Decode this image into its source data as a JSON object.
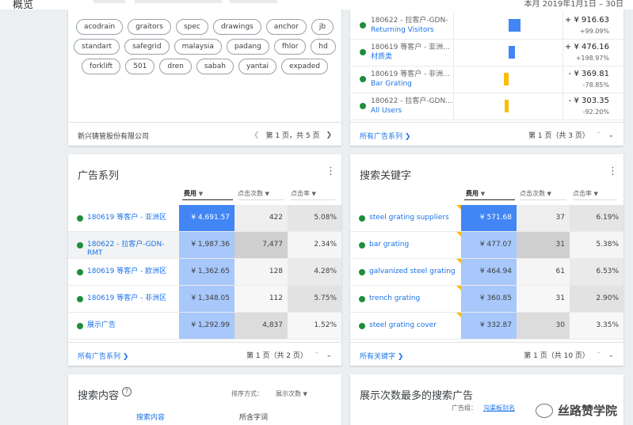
{
  "topbar": {
    "title": "概览",
    "date_range": "本月  2019年1月1日 – 30日"
  },
  "keyword_cloud": {
    "rows": [
      [
        "acodrain",
        "graitors",
        "spec",
        "drawings",
        "anchor",
        "jb"
      ],
      [
        "standart",
        "safegrid",
        "malaysia",
        "padang",
        "fhlor",
        "hd"
      ],
      [
        "forklift",
        "501",
        "dren",
        "sabah",
        "yantai",
        "expaded"
      ]
    ],
    "footer_left": "新兴铸管股份有限公司",
    "footer_page": "第 1 页，共 5 页"
  },
  "changes": {
    "rows": [
      {
        "title": "180622 - 拉客户-GDN-",
        "sub": "Returning Visitors",
        "value": "+ ¥ 916.63",
        "pct": "+99.09%",
        "bar_color": "#4285f4",
        "bar_width": 15
      },
      {
        "title": "180619 等客户 - 亚洲...",
        "sub": "材质类",
        "value": "+ ¥ 476.16",
        "pct": "+198.97%",
        "bar_color": "#4285f4",
        "bar_width": 8
      },
      {
        "title": "180619 等客户 - 非洲...",
        "sub": "Bar Grating",
        "value": "- ¥ 369.81",
        "pct": "-78.85%",
        "bar_color": "#fbbc04",
        "bar_width": 6
      },
      {
        "title": "180622 - 拉客户-GDN...",
        "sub": "All Users",
        "value": "- ¥ 303.35",
        "pct": "-92.20%",
        "bar_color": "#fbbc04",
        "bar_width": 5
      }
    ],
    "footer_link": "所有广告系列",
    "footer_page": "第 1 页（共 3 页）"
  },
  "campaigns": {
    "title": "广告系列",
    "headers": [
      "费用",
      "点击次数",
      "点击率"
    ],
    "rows": [
      {
        "name": "180619 等客户 - 亚洲区",
        "cost": "¥ 4,691.57",
        "clicks": "422",
        "ctr": "5.08%"
      },
      {
        "name": "180622 - 拉客户-GDN-RMT",
        "cost": "¥ 1,987.36",
        "clicks": "7,477",
        "ctr": "2.34%"
      },
      {
        "name": "180619 等客户 - 欧洲区",
        "cost": "¥ 1,362.65",
        "clicks": "128",
        "ctr": "4.28%"
      },
      {
        "name": "180619 等客户 - 非洲区",
        "cost": "¥ 1,348.05",
        "clicks": "112",
        "ctr": "5.75%"
      },
      {
        "name": "展示广告",
        "cost": "¥ 1,292.99",
        "clicks": "4,837",
        "ctr": "1.52%"
      }
    ],
    "footer_link": "所有广告系列",
    "footer_page": "第 1 页（共 2 页）"
  },
  "keywords": {
    "title": "搜索关键字",
    "headers": [
      "费用",
      "点击次数",
      "点击率"
    ],
    "rows": [
      {
        "name": "steel grating suppliers",
        "cost": "¥ 571.68",
        "clicks": "37",
        "ctr": "6.19%"
      },
      {
        "name": "bar grating",
        "cost": "¥ 477.07",
        "clicks": "31",
        "ctr": "5.38%"
      },
      {
        "name": "galvanized steel grating",
        "cost": "¥ 464.94",
        "clicks": "61",
        "ctr": "6.53%"
      },
      {
        "name": "trench grating",
        "cost": "¥ 360.85",
        "clicks": "31",
        "ctr": "2.90%"
      },
      {
        "name": "steel grating cover",
        "cost": "¥ 332.87",
        "clicks": "30",
        "ctr": "3.35%"
      }
    ],
    "footer_link": "所有关键字",
    "footer_page": "第 1 页（共 10 页）"
  },
  "search_terms": {
    "title": "搜索内容",
    "sort_label": "排序方式：",
    "sort_value": "展示次数",
    "col1": "搜索内容",
    "col2": "所含字词"
  },
  "top_ads": {
    "title": "展示次数最多的搜索广告",
    "group_label": "广告组：",
    "group_value": "沟渠板别名"
  },
  "watermark": "丝路赞学院"
}
